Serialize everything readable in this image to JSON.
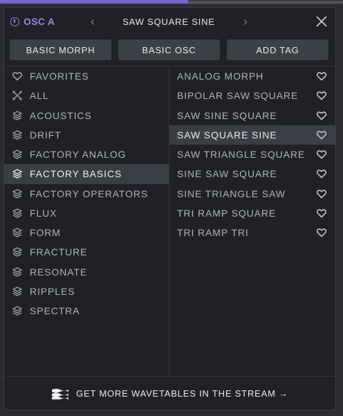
{
  "header": {
    "osc_label": "OSC A",
    "preset_name": "SAW SQUARE SINE",
    "prev_glyph": "‹",
    "next_glyph": "›",
    "accent_color": "#9a84e8"
  },
  "buttons": {
    "basic_morph": "BASIC MORPH",
    "basic_osc": "BASIC OSC",
    "add_tag": "ADD TAG"
  },
  "categories": [
    {
      "label": "FAVORITES",
      "icon": "heart-icon"
    },
    {
      "label": "ALL",
      "icon": "all-icon"
    },
    {
      "label": "ACOUSTICS",
      "icon": "layers-icon"
    },
    {
      "label": "DRIFT",
      "icon": "layers-icon"
    },
    {
      "label": "FACTORY ANALOG",
      "icon": "layers-icon"
    },
    {
      "label": "FACTORY BASICS",
      "icon": "layers-icon",
      "selected": true
    },
    {
      "label": "FACTORY OPERATORS",
      "icon": "layers-icon"
    },
    {
      "label": "FLUX",
      "icon": "layers-icon"
    },
    {
      "label": "FORM",
      "icon": "layers-icon"
    },
    {
      "label": "FRACTURE",
      "icon": "layers-icon"
    },
    {
      "label": "RESONATE",
      "icon": "layers-icon"
    },
    {
      "label": "RIPPLES",
      "icon": "layers-icon"
    },
    {
      "label": "SPECTRA",
      "icon": "layers-icon"
    }
  ],
  "wavetables": [
    {
      "label": "ANALOG MORPH"
    },
    {
      "label": "BIPOLAR SAW SQUARE"
    },
    {
      "label": "SAW SINE SQUARE"
    },
    {
      "label": "SAW SQUARE SINE",
      "selected": true
    },
    {
      "label": "SAW TRIANGLE SQUARE"
    },
    {
      "label": "SINE SAW SQUARE"
    },
    {
      "label": "SINE TRIANGLE SAW"
    },
    {
      "label": "TRI RAMP SQUARE"
    },
    {
      "label": "TRI RAMP TRI"
    }
  ],
  "footer": {
    "text": "GET MORE WAVETABLES IN THE STREAM →",
    "icon": "stream-logo-icon"
  }
}
